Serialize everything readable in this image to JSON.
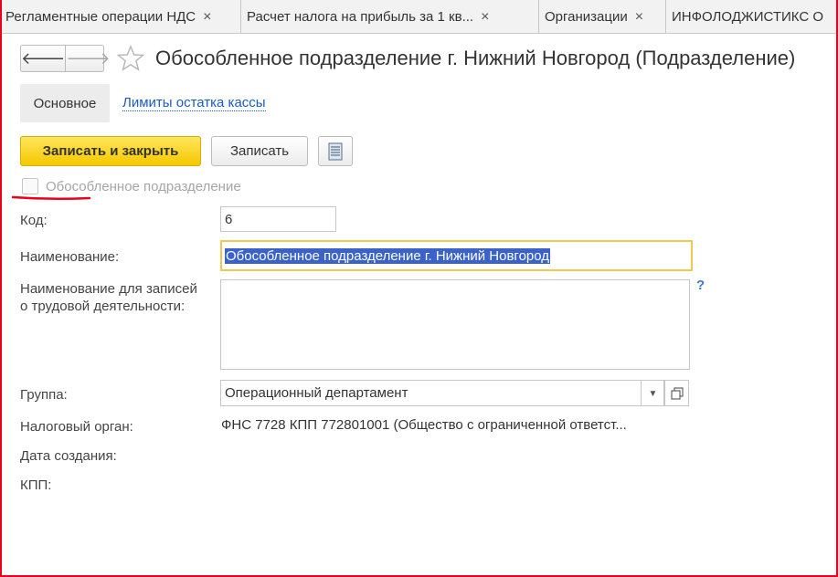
{
  "tabs": [
    {
      "label": "Регламентные операции НДС"
    },
    {
      "label": "Расчет налога на прибыль за 1 кв..."
    },
    {
      "label": "Организации"
    },
    {
      "label": "ИНФОЛОДЖИСТИКС О"
    }
  ],
  "tab_close_glyph": "×",
  "header": {
    "back_glyph": "🡐",
    "forward_glyph": "🡒",
    "title": "Обособленное подразделение г. Нижний Новгород (Подразделение)"
  },
  "section_tabs": {
    "main": "Основное",
    "cash_limits": "Лимиты остатка кассы"
  },
  "toolbar": {
    "save_close_label": "Записать и закрыть",
    "save_label": "Записать"
  },
  "separate_division": {
    "label": "Обособленное подразделение",
    "checked": false
  },
  "fields": {
    "code": {
      "label": "Код:",
      "value": "6"
    },
    "name": {
      "label": "Наименование:",
      "value": "Обособленное подразделение г. Нижний Новгород"
    },
    "labor_name": {
      "label_line1": "Наименование для записей",
      "label_line2": "о трудовой деятельности:",
      "value": "",
      "help": "?"
    },
    "group": {
      "label": "Группа:",
      "value": "Операционный департамент"
    },
    "tax_authority": {
      "label": "Налоговый орган:",
      "value": "ФНС 7728 КПП 772801001 (Общество с ограниченной ответст..."
    },
    "creation_date": {
      "label": "Дата создания:"
    },
    "kpp": {
      "label": "КПП:"
    }
  },
  "colors": {
    "primary_button": "#f5c800",
    "link": "#1a5bc4",
    "focus_border": "#f0c84e",
    "selection": "#3a62c8",
    "annotation_red": "#e8001c"
  }
}
